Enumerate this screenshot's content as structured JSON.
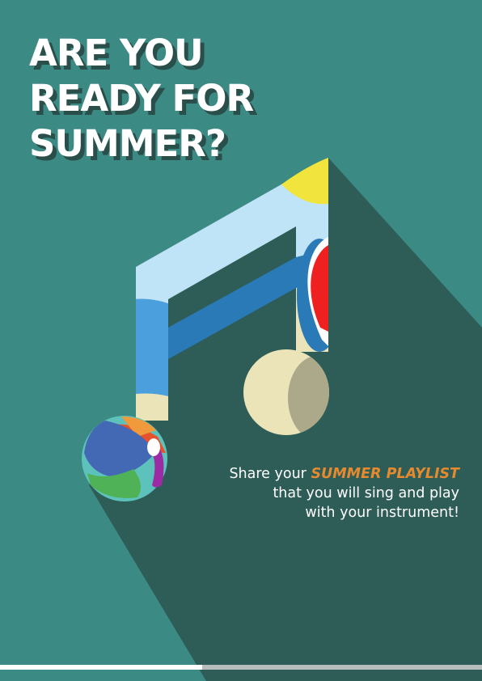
{
  "headline": {
    "line1": "ARE YOU",
    "line2": "READY FOR",
    "line3": "SUMMER?"
  },
  "tagline": {
    "prefix": "Share your ",
    "highlight": "SUMMER PLAYLIST",
    "line2": "that you will sing and play",
    "line3": "with your instrument!"
  },
  "colors": {
    "background": "#3c8a84",
    "shadow": "#2e5d58",
    "highlight": "#e58a2e",
    "text": "#ffffff",
    "note_light_blue": "#bfe3f7",
    "note_mid_blue": "#4a9fdc",
    "note_dark_blue": "#2a7ab8",
    "note_sand": "#ebe4b8",
    "note_sun": "#f1e43c",
    "note_red": "#ef2020"
  },
  "icons": {
    "music_note": "music-note-icon",
    "beach_ball": "beach-ball-icon",
    "sun": "sun-icon",
    "umbrella": "umbrella-icon"
  }
}
